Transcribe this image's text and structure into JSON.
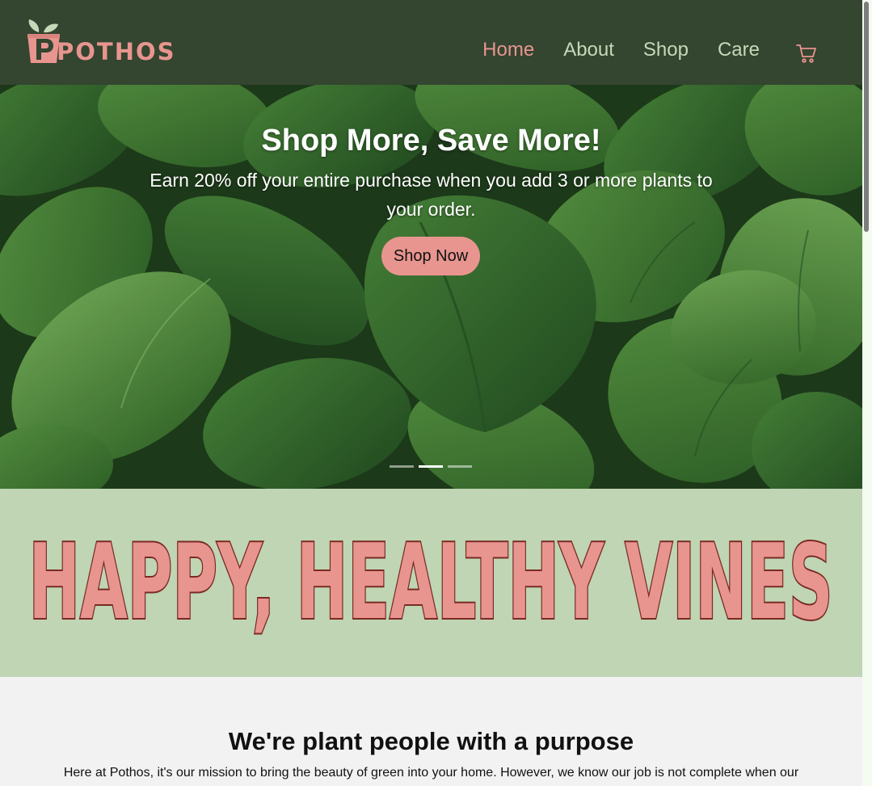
{
  "brand": {
    "logo_text": "POTHOS",
    "color_primary": "#344530",
    "color_accent": "#e8958f",
    "color_light_green": "#bfd5b4"
  },
  "nav": {
    "items": [
      {
        "label": "Home",
        "active": true
      },
      {
        "label": "About",
        "active": false
      },
      {
        "label": "Shop",
        "active": false
      },
      {
        "label": "Care",
        "active": false
      }
    ],
    "cart_icon": "cart-icon"
  },
  "hero": {
    "title": "Shop More, Save More!",
    "text": "Earn 20% off your entire purchase when you add 3 or more plants to your order.",
    "button_label": "Shop Now",
    "slides": 3,
    "active_slide": 2
  },
  "banner": {
    "headline": "HAPPY, HEALTHY VINES"
  },
  "about": {
    "title": "We're plant people with a purpose",
    "text": "Here at Pothos, it's our mission to bring the beauty of green into your home. However, we know our job is not complete when our"
  }
}
